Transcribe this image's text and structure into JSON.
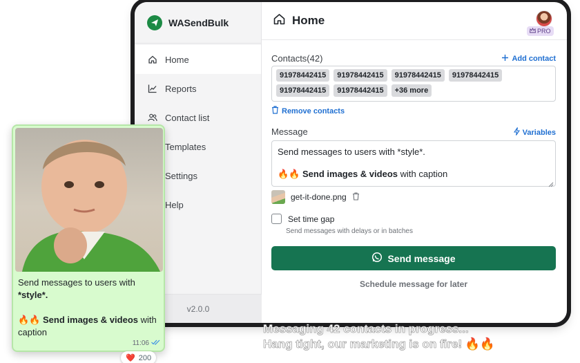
{
  "app": {
    "brand": "WASendBulk",
    "version": "v2.0.0",
    "page_title": "Home",
    "pro_badge": "PRO"
  },
  "sidebar": {
    "items": [
      {
        "label": "Home",
        "icon": "home-icon",
        "active": true
      },
      {
        "label": "Reports",
        "icon": "chart-icon",
        "active": false
      },
      {
        "label": "Contact list",
        "icon": "users-icon",
        "active": false
      },
      {
        "label": "Templates",
        "icon": "template-icon",
        "active": false
      },
      {
        "label": "Settings",
        "icon": "gear-icon",
        "active": false
      },
      {
        "label": "Help",
        "icon": "help-icon",
        "active": false
      }
    ]
  },
  "contacts": {
    "label": "Contacts(42)",
    "add_label": "Add contact",
    "chips": [
      "91978442415",
      "91978442415",
      "91978442415",
      "91978442415",
      "91978442415",
      "91978442415",
      "+36 more"
    ],
    "remove_label": "Remove contacts"
  },
  "message": {
    "label": "Message",
    "variables_label": "Variables",
    "line1": "Send messages to users with *style*.",
    "line2_emoji": "🔥🔥",
    "line2_bold": "Send images & videos",
    "line2_rest": " with caption",
    "attachment": "get-it-done.png"
  },
  "time_gap": {
    "label": "Set time gap",
    "hint": "Send messages with delays or in batches"
  },
  "actions": {
    "send_label": "Send message",
    "schedule_label": "Schedule message for later"
  },
  "preview": {
    "line1": "Send messages to users with",
    "line1b": "*style*.",
    "line2_emoji": "🔥🔥",
    "line2_bold": "Send images & videos",
    "line2_rest": " with",
    "line3": "caption",
    "time": "11:06",
    "reaction_emoji": "❤️",
    "reaction_count": "200"
  },
  "caption": {
    "line1": "Messaging 42 contacts in progress...",
    "line2": "Hang tight, our marketing is on fire! 🔥🔥"
  },
  "colors": {
    "brand_green": "#167451",
    "link_blue": "#1f6fd1",
    "card_green": "#d8fbce"
  }
}
